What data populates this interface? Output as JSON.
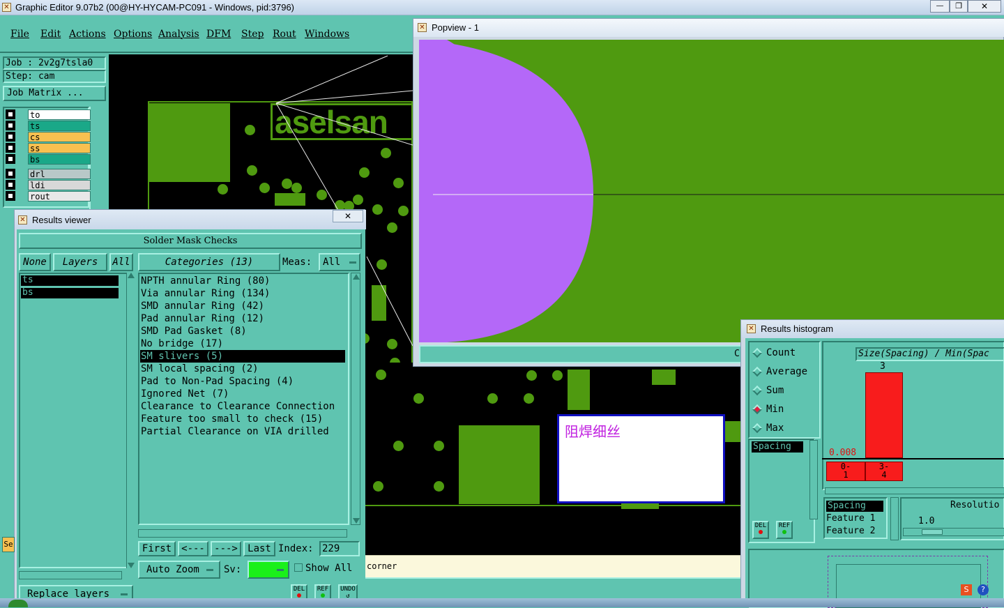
{
  "app": {
    "title": "Graphic Editor 9.07b2 (00@HY-HYCAM-PC091 - Windows, pid:3796)",
    "minimize": "—",
    "restore": "❐",
    "close": "✕"
  },
  "menu": [
    "File",
    "Edit",
    "Actions",
    "Options",
    "Analysis",
    "DFM",
    "Step",
    "Rout",
    "Windows"
  ],
  "job": {
    "job_label": "Job : 2v2g7tsla0",
    "step_label": "Step: cam",
    "matrix_button": "Job Matrix ..."
  },
  "layers": [
    {
      "name": "to",
      "color": "#ffffff"
    },
    {
      "name": "ts",
      "color": "#1aa888"
    },
    {
      "name": "cs",
      "color": "#f8c050"
    },
    {
      "name": "ss",
      "color": "#f8c050"
    },
    {
      "name": "bs",
      "color": "#1aa888"
    },
    {
      "name": "drl",
      "color": "#b8c8c8"
    },
    {
      "name": "ldi",
      "color": "#d8d8d8"
    },
    {
      "name": "rout",
      "color": "#e8e8e8"
    }
  ],
  "canvas": {
    "board_text": "aselsan",
    "corner_label": "corner"
  },
  "popview": {
    "title": "Popview - 1",
    "stub": "C"
  },
  "results_viewer": {
    "title": "Results viewer",
    "close": "✕",
    "header": "Solder Mask Checks",
    "none_btn": "None",
    "layers_btn": "Layers",
    "all_btn": "All",
    "categories_btn": "Categories (13)",
    "meas_label": "Meas:",
    "meas_value": "All",
    "layer_list": [
      "ts",
      "bs"
    ],
    "categories": [
      "NPTH annular Ring (80)",
      "Via annular Ring (134)",
      "SMD annular Ring (42)",
      "Pad annular Ring (12)",
      "SMD Pad Gasket (8)",
      "No bridge (17)",
      "SM slivers (5)",
      "SM local spacing (2)",
      "Pad to Non-Pad Spacing (4)",
      "Ignored Net (7)",
      "Clearance to Clearance Connection",
      "Feature too small to check (15)",
      "Partial Clearance on VIA drilled"
    ],
    "selected_category": "SM slivers (5)",
    "first": "First",
    "prev": "<---",
    "next": "--->",
    "last": "Last",
    "index_label": "Index:",
    "index_value": "229",
    "auto_zoom": "Auto Zoom",
    "sv_label": "Sv:",
    "show_all": "Show All",
    "replace_layers": "Replace layers",
    "del": "DEL",
    "ref": "REF",
    "undo": "UNDO"
  },
  "note_box": {
    "text": "阻焊细丝"
  },
  "histogram": {
    "title": "Results histogram",
    "options": [
      {
        "label": "Count",
        "selected": false
      },
      {
        "label": "Average",
        "selected": false
      },
      {
        "label": "Sum",
        "selected": false
      },
      {
        "label": "Min",
        "selected": true
      },
      {
        "label": "Max",
        "selected": false
      }
    ],
    "list_item": "Spacing",
    "chart_header": "Size(Spacing) / Min(Spac",
    "bar_top_label": "3",
    "y_label": "0.008",
    "bins": [
      {
        "label_top": "0-",
        "label_bottom": "1"
      },
      {
        "label_top": "3-",
        "label_bottom": "4"
      }
    ],
    "table": [
      "Spacing",
      "Feature 1",
      "Feature 2"
    ],
    "resolution_label": "Resolutio",
    "resolution_value": "1.0",
    "del": "DEL",
    "ref": "REF"
  },
  "colors": {
    "teal": "#5fc4b0",
    "green": "#4f9a10",
    "violet": "#b468f8",
    "red": "#f81c1c",
    "black": "#000000"
  }
}
